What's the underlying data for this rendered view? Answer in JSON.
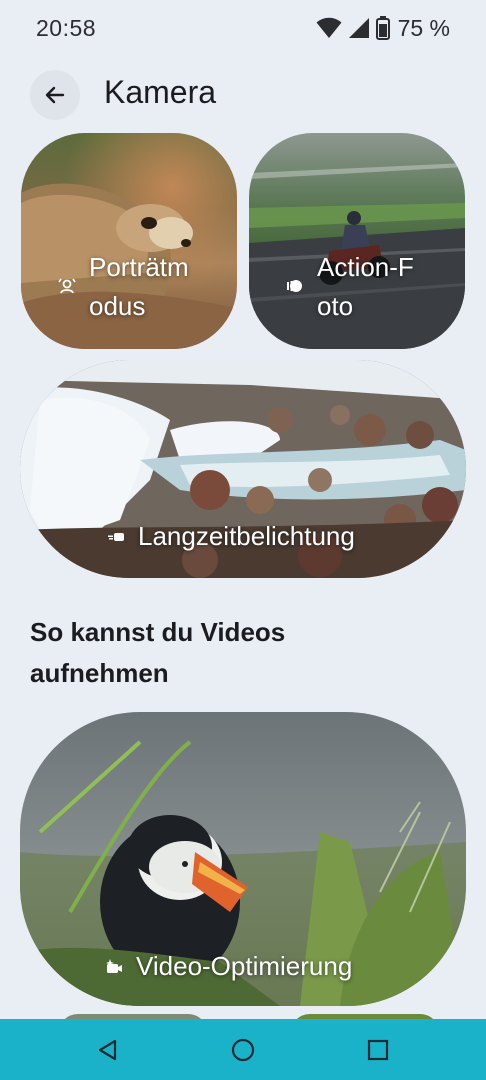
{
  "status_bar": {
    "time": "20:58",
    "battery": "75 %"
  },
  "header": {
    "title": "Kamera",
    "back_icon": "arrow-back-icon"
  },
  "photo_modes": [
    {
      "label_line1": "Porträtm",
      "label_line2": "odus",
      "icon": "portrait-icon"
    },
    {
      "label_line1": "Action-F",
      "label_line2": "oto",
      "icon": "action-pan-icon"
    },
    {
      "label": "Langzeitbelichtung",
      "icon": "long-exposure-icon"
    }
  ],
  "video_section": {
    "heading_line1": "So kannst du Videos",
    "heading_line2": "aufnehmen",
    "cards": [
      {
        "label": "Video-Optimierung",
        "icon": "video-boost-icon"
      }
    ]
  },
  "nav_bar": {
    "color": "#1ab2c9",
    "buttons": [
      "back-triangle-icon",
      "home-circle-icon",
      "recents-square-icon"
    ]
  },
  "colors": {
    "background": "#e9edf4",
    "text": "#1b1c1f"
  }
}
